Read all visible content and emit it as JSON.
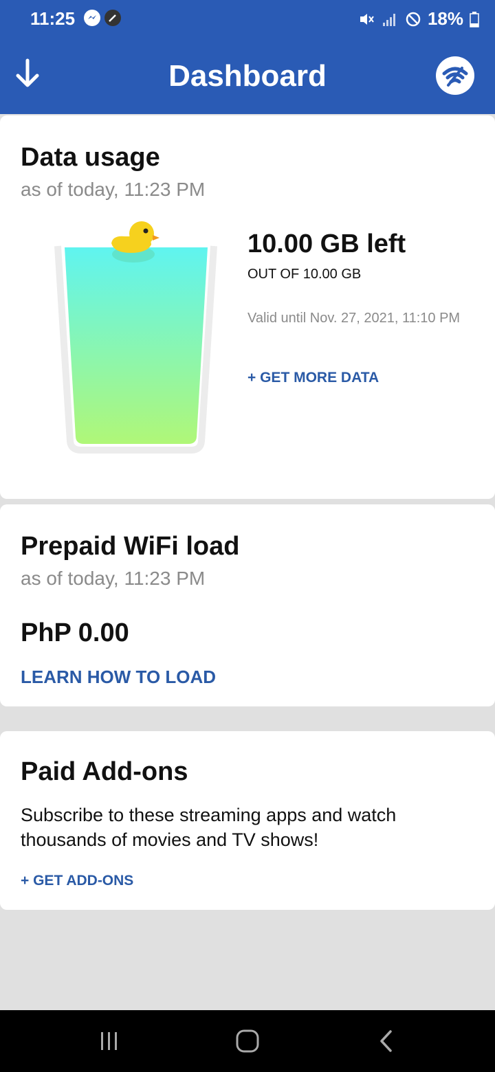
{
  "status_bar": {
    "time": "11:25",
    "battery": "18%"
  },
  "app_bar": {
    "title": "Dashboard"
  },
  "data_usage": {
    "title": "Data usage",
    "as_of": "as of today, 11:23 PM",
    "amount_left": "10.00 GB left",
    "total": "OUT OF 10.00 GB",
    "valid_until": "Valid until Nov. 27, 2021, 11:10 PM",
    "action": "+ GET MORE DATA",
    "remaining_fraction": 1.0
  },
  "prepaid_wifi": {
    "title": "Prepaid WiFi load",
    "as_of": "as of today, 11:23 PM",
    "balance": "PhP 0.00",
    "action": "LEARN HOW TO LOAD"
  },
  "paid_addons": {
    "title": "Paid Add-ons",
    "description": "Subscribe to these streaming apps and watch thousands of movies and TV shows!",
    "action": "+ GET ADD-ONS"
  },
  "colors": {
    "primary": "#2a5bb5",
    "link": "#2a5aa6"
  },
  "icons": [
    "messenger-icon",
    "edit-icon",
    "mute-icon",
    "signal-icon",
    "dnd-icon",
    "battery-icon",
    "download-icon",
    "wifi-logo-icon",
    "duck-icon",
    "recents-icon",
    "home-icon",
    "back-icon"
  ]
}
